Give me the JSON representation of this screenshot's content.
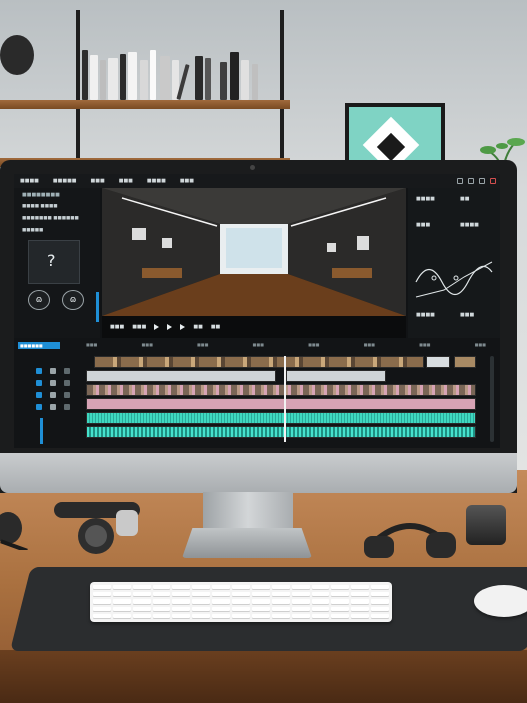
{
  "app": {
    "menu_items": [
      "■■■■",
      "■■■■■",
      "■■■",
      "■■■",
      "■■■■",
      "■■■"
    ],
    "right_icons": [
      "window-icon",
      "window-icon",
      "window-icon",
      "close-icon"
    ]
  },
  "left_panel": {
    "title": "■■■■■■■■",
    "items": [
      "■■■■ ■■■■",
      "■■■■■■■ ■■■■■■",
      "■■■■■"
    ],
    "ear_buttons": [
      "ɷ",
      "ɷ"
    ]
  },
  "viewer": {
    "controls": [
      "■■■",
      "■■■",
      "■■",
      "■■"
    ]
  },
  "right_panel": {
    "labels": [
      "■■■■",
      "■■",
      "■■■",
      "■■■■",
      "■■■■",
      "■■■"
    ]
  },
  "timeline": {
    "tab_label": "■■■■■■",
    "ruler_ticks": [
      "■■■",
      "■■■",
      "■■■",
      "■■■",
      "■■■",
      "■■■",
      "■■■",
      "■■■"
    ]
  },
  "colors": {
    "accent": "#1f8fd6",
    "track_audio": "#3fd7c0",
    "track_pink": "#d7a3b5",
    "bg": "#111315"
  }
}
